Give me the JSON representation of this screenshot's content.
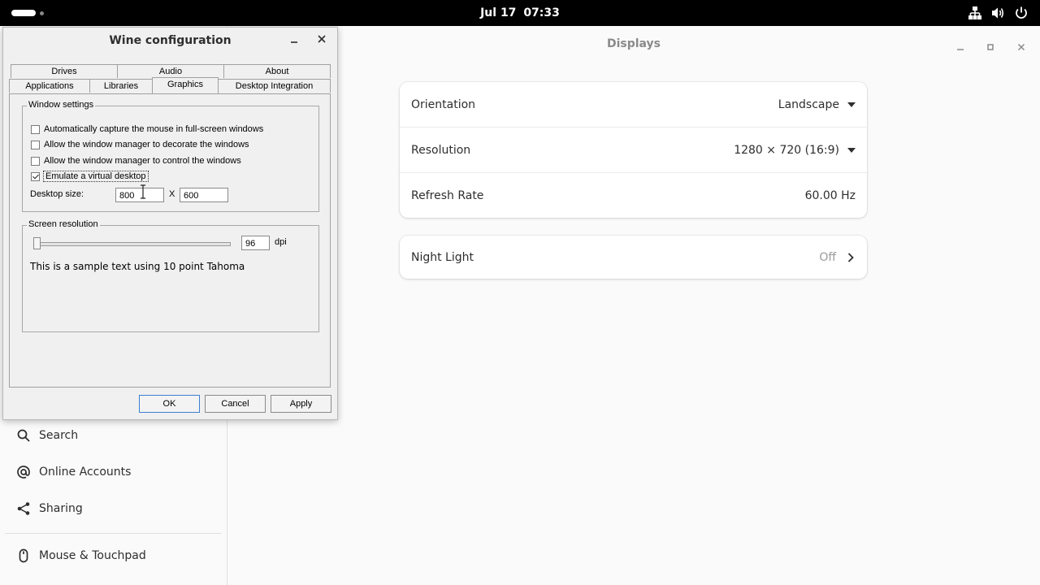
{
  "topbar": {
    "date": "Jul 17",
    "time": "07:33",
    "tray": [
      "network-icon",
      "volume-icon",
      "power-icon"
    ]
  },
  "settings": {
    "header_title": "Displays",
    "sidebar_items": [
      {
        "label": "Search",
        "icon": "search-icon"
      },
      {
        "label": "Online Accounts",
        "icon": "at-sign-icon"
      },
      {
        "label": "Sharing",
        "icon": "share-icon"
      },
      {
        "label": "Mouse & Touchpad",
        "icon": "mouse-icon"
      }
    ],
    "display_card": [
      {
        "label": "Orientation",
        "value": "Landscape"
      },
      {
        "label": "Resolution",
        "value": "1280 × 720 (16:9)"
      },
      {
        "label": "Refresh Rate",
        "value": "60.00 Hz"
      }
    ],
    "night_light": {
      "label": "Night Light",
      "value": "Off"
    }
  },
  "wine": {
    "title": "Wine configuration",
    "tabs_top": [
      "Drives",
      "Audio",
      "About"
    ],
    "tabs_bottom": [
      "Applications",
      "Libraries",
      "Graphics",
      "Desktop Integration"
    ],
    "active_tab": "Graphics",
    "window_settings": {
      "title": "Window settings",
      "options": [
        {
          "label": "Automatically capture the mouse in full-screen windows",
          "checked": false
        },
        {
          "label": "Allow the window manager to decorate the windows",
          "checked": false
        },
        {
          "label": "Allow the window manager to control the windows",
          "checked": false
        },
        {
          "label": "Emulate a virtual desktop",
          "checked": true
        }
      ],
      "desktop_size_label": "Desktop size:",
      "width": "800",
      "x_label": "X",
      "height": "600"
    },
    "screen_resolution": {
      "title": "Screen resolution",
      "dpi": "96",
      "dpi_unit": "dpi",
      "sample_text": "This is a sample text using 10 point Tahoma"
    },
    "buttons": {
      "ok": "OK",
      "cancel": "Cancel",
      "apply": "Apply"
    }
  },
  "colors": {
    "topbar": "#000000",
    "background": "#fafafa",
    "card": "#ffffff",
    "dialog": "#f0f0f0",
    "default_button_border": "#3c7fd1"
  }
}
